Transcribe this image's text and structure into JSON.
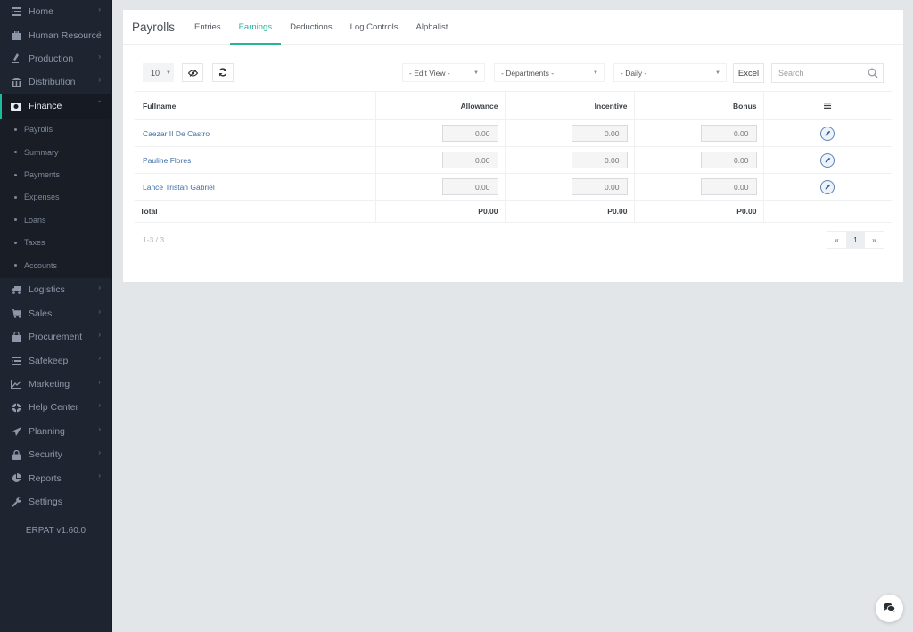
{
  "sidebar": {
    "items_top": [
      {
        "label": "Home",
        "icon": "home-icon"
      },
      {
        "label": "Human Resource",
        "icon": "briefcase-icon"
      },
      {
        "label": "Production",
        "icon": "flask-icon"
      },
      {
        "label": "Distribution",
        "icon": "bank-icon"
      }
    ],
    "active": {
      "label": "Finance",
      "icon": "money-icon"
    },
    "sub_items": [
      "Payrolls",
      "Summary",
      "Payments",
      "Expenses",
      "Loans",
      "Taxes",
      "Accounts"
    ],
    "items_bottom": [
      {
        "label": "Logistics",
        "icon": "truck-icon"
      },
      {
        "label": "Sales",
        "icon": "cart-icon"
      },
      {
        "label": "Procurement",
        "icon": "lock-bag-icon"
      },
      {
        "label": "Safekeep",
        "icon": "list-icon"
      },
      {
        "label": "Marketing",
        "icon": "chart-line-icon"
      },
      {
        "label": "Help Center",
        "icon": "lifebuoy-icon"
      },
      {
        "label": "Planning",
        "icon": "paper-plane-icon"
      },
      {
        "label": "Security",
        "icon": "padlock-icon"
      },
      {
        "label": "Reports",
        "icon": "pie-chart-icon"
      },
      {
        "label": "Settings",
        "icon": "wrench-icon"
      }
    ],
    "version": "ERPAT v1.60.0"
  },
  "header": {
    "title": "Payrolls",
    "tabs": [
      "Entries",
      "Earnings",
      "Deductions",
      "Log Controls",
      "Alphalist"
    ],
    "active_tab": "Earnings"
  },
  "toolbar": {
    "page_size": "10",
    "edit_view": "- Edit View -",
    "departments": "- Departments -",
    "period": "- Daily -",
    "excel_label": "Excel",
    "search_placeholder": "Search"
  },
  "table": {
    "columns": [
      "Fullname",
      "Allowance",
      "Incentive",
      "Bonus"
    ],
    "rows": [
      {
        "name": "Caezar II De Castro",
        "allowance": "0.00",
        "incentive": "0.00",
        "bonus": "0.00"
      },
      {
        "name": "Pauline Flores",
        "allowance": "0.00",
        "incentive": "0.00",
        "bonus": "0.00"
      },
      {
        "name": "Lance Tristan Gabriel",
        "allowance": "0.00",
        "incentive": "0.00",
        "bonus": "0.00"
      }
    ],
    "total": {
      "label": "Total",
      "allowance": "P0.00",
      "incentive": "P0.00",
      "bonus": "P0.00"
    }
  },
  "footer": {
    "info": "1-3 / 3",
    "prev": "«",
    "current_page": "1",
    "next": "»"
  },
  "colors": {
    "accent": "#2ab39a",
    "link": "#3e6fa8",
    "sidebar_bg": "#1f2530"
  }
}
